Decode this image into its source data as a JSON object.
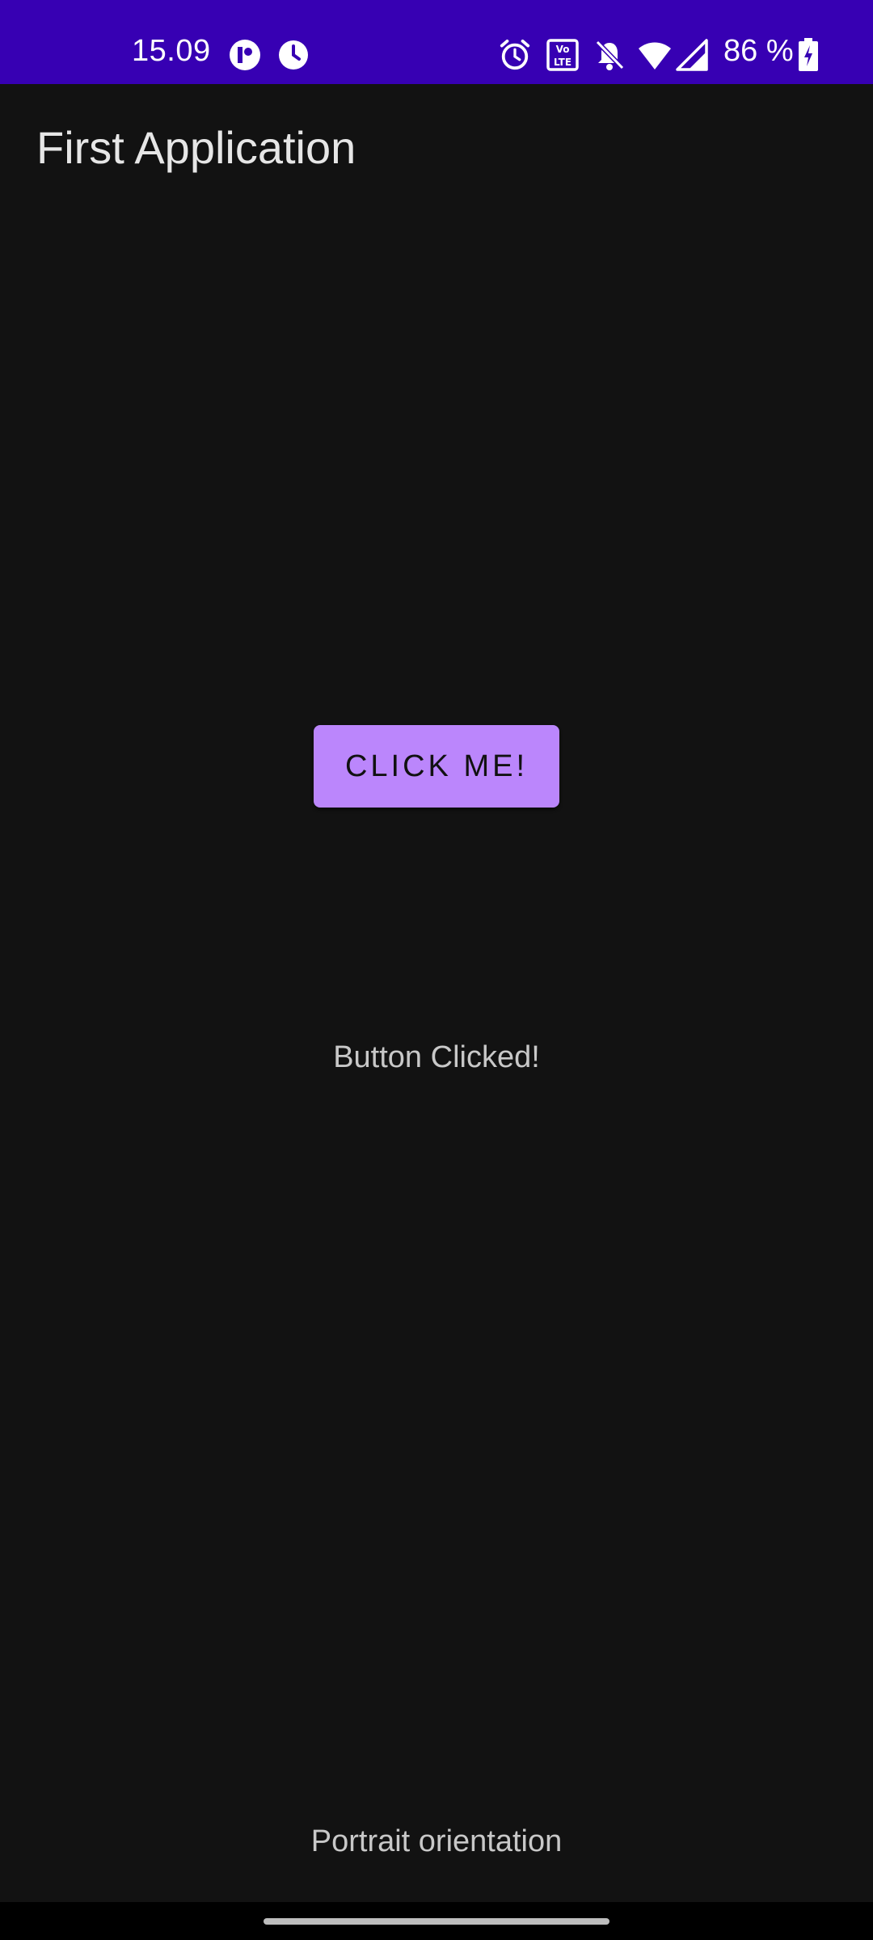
{
  "status_bar": {
    "time": "15.09",
    "battery_text": "86 %",
    "icons": [
      "p-logo-icon",
      "clock-badge-icon",
      "alarm-icon",
      "volte-icon",
      "bell-muted-icon",
      "wifi-icon",
      "signal-icon",
      "battery-charging-icon"
    ],
    "background_color": "#3700b3"
  },
  "app_bar": {
    "title": "First Application"
  },
  "main": {
    "button_label": "CLICK ME!",
    "button_color": "#bb86fc",
    "result_text": "Button Clicked!",
    "orientation_text": "Portrait orientation"
  },
  "theme": {
    "background": "#121212"
  }
}
